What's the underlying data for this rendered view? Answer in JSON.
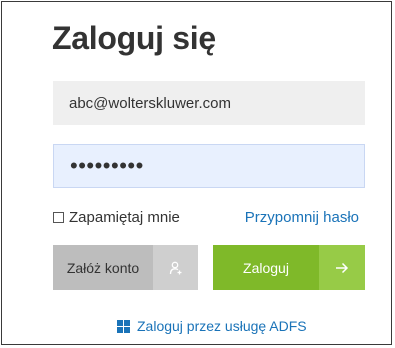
{
  "title": "Zaloguj się",
  "email": {
    "value": "abc@wolterskluwer.com"
  },
  "password": {
    "masked_value": "•••••••••"
  },
  "remember": {
    "label": "Zapamiętaj mnie",
    "checked": false
  },
  "forgot_link": "Przypomnij hasło",
  "create_account_button": {
    "label": "Załóż konto",
    "icon": "add-user-icon"
  },
  "login_button": {
    "label": "Zaloguj",
    "icon": "arrow-right-icon"
  },
  "adfs_link": {
    "label": "Zaloguj przez usługę ADFS",
    "icon": "windows-logo-icon"
  },
  "colors": {
    "accent_green": "#7fb929",
    "link_blue": "#1a73b8",
    "grey_button": "#bdbdbd"
  }
}
